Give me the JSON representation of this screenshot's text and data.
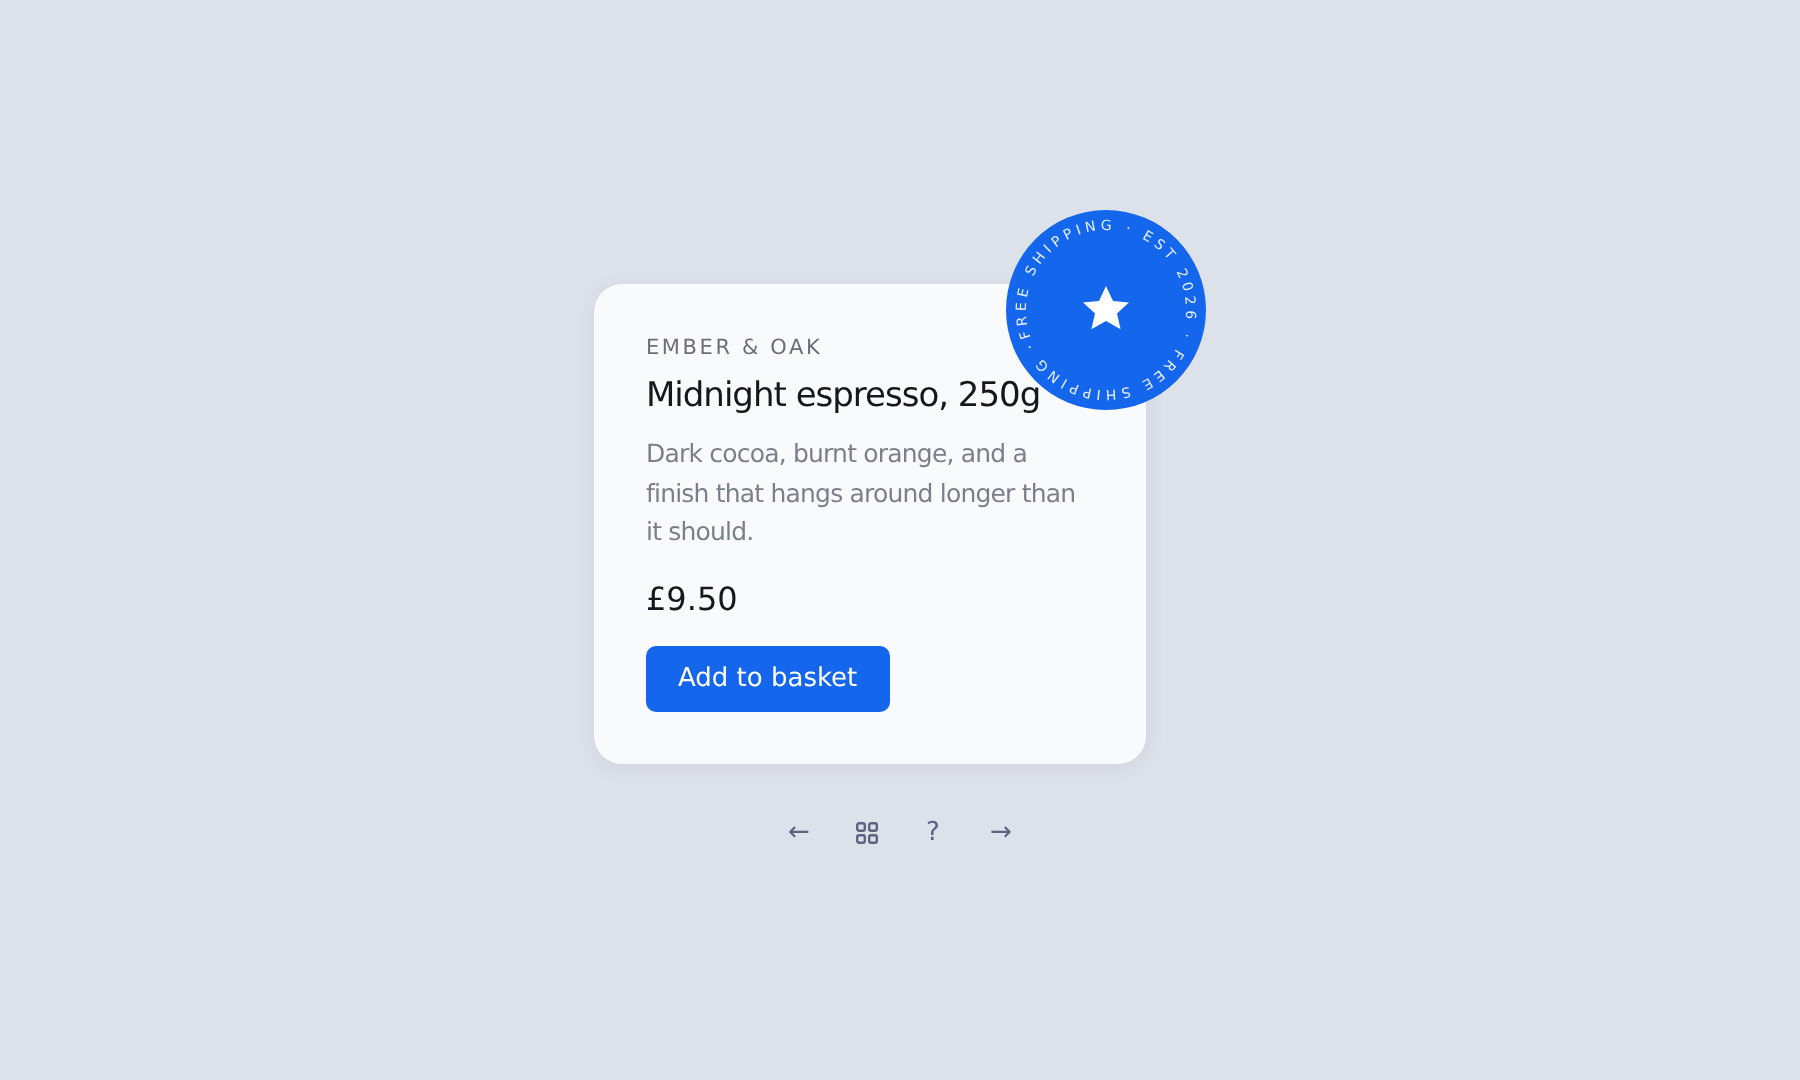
{
  "product": {
    "brand": "EMBER & OAK",
    "title": "Midnight espresso, 250g",
    "description": "Dark cocoa, burnt orange, and a finish that hangs around longer than it should.",
    "price": "£9.50",
    "button": "Add to basket"
  },
  "badge": {
    "text": "FREE SHIPPING · EST 2026 · FREE SHIPPING ·"
  },
  "nav": [
    {
      "kind": "text",
      "label": "←"
    },
    {
      "kind": "grid"
    },
    {
      "kind": "text",
      "label": "?"
    },
    {
      "kind": "text",
      "label": "→"
    }
  ]
}
